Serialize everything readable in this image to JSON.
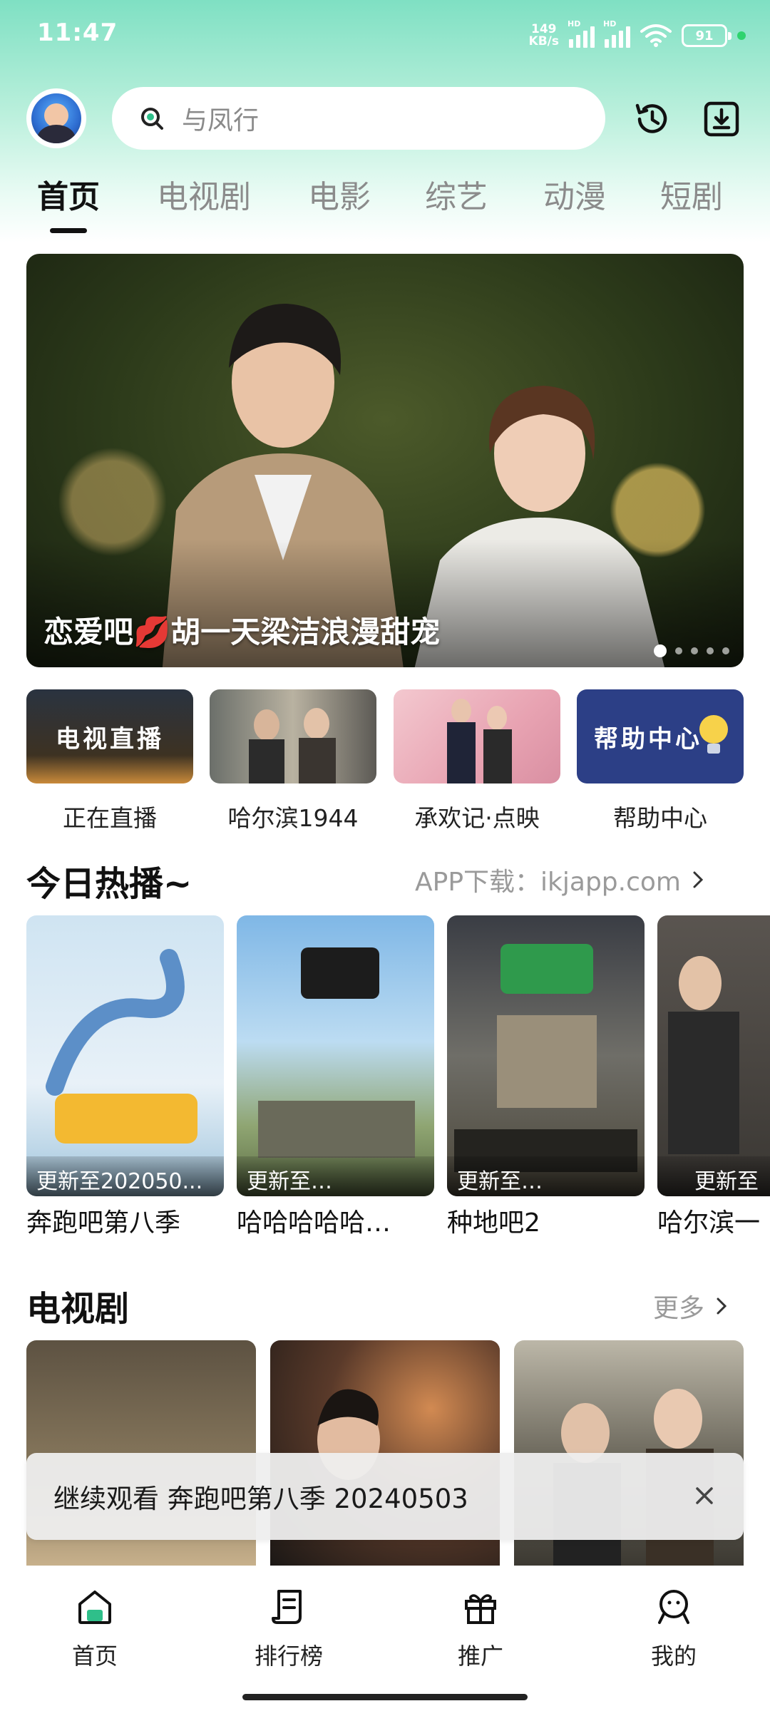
{
  "status_bar": {
    "time": "11:47",
    "net_speed_value": "149",
    "net_speed_unit": "KB/s",
    "signal_label": "HD",
    "battery": "91"
  },
  "header": {
    "search_placeholder": "与凤行"
  },
  "tabs": [
    {
      "label": "首页",
      "active": true
    },
    {
      "label": "电视剧",
      "active": false
    },
    {
      "label": "电影",
      "active": false
    },
    {
      "label": "综艺",
      "active": false
    },
    {
      "label": "动漫",
      "active": false
    },
    {
      "label": "短剧",
      "active": false
    }
  ],
  "banner": {
    "title": "恋爱吧💋胡一天梁洁浪漫甜宠",
    "dot_count": 5,
    "active_dot": 0
  },
  "quick_entries": [
    {
      "label": "正在直播",
      "thumb_text": "电视直播"
    },
    {
      "label": "哈尔滨1944",
      "thumb_text": ""
    },
    {
      "label": "承欢记·点映",
      "thumb_text": ""
    },
    {
      "label": "帮助中心",
      "thumb_text": "帮助中心"
    }
  ],
  "hot_section": {
    "title": "今日热播~",
    "link_text": "APP下载：ikjapp.com",
    "items": [
      {
        "title": "奔跑吧第八季",
        "badge": "更新至202050..."
      },
      {
        "title": "哈哈哈哈哈…",
        "badge": "更新至…"
      },
      {
        "title": "种地吧2",
        "badge": "更新至…"
      },
      {
        "title": "哈尔滨一",
        "badge": "更新至"
      }
    ]
  },
  "tv_section": {
    "title": "电视剧",
    "more_label": "更多"
  },
  "continue_bar": {
    "text": "继续观看 奔跑吧第八季 20240503"
  },
  "bottom_nav": [
    {
      "label": "首页",
      "icon": "home-icon",
      "active": true
    },
    {
      "label": "排行榜",
      "icon": "ranking-icon",
      "active": false
    },
    {
      "label": "推广",
      "icon": "gift-icon",
      "active": false
    },
    {
      "label": "我的",
      "icon": "profile-icon",
      "active": false
    }
  ],
  "colors": {
    "accent": "#2fbf8a",
    "header_gradient_top": "#7fe0c3",
    "text_primary": "#111111",
    "text_secondary": "#8b8b8b"
  }
}
